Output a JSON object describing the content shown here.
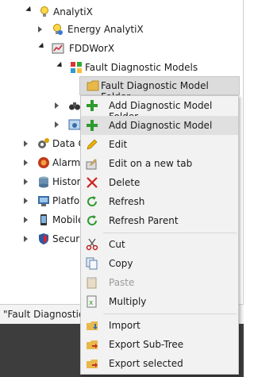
{
  "tree": {
    "analytix": "AnalytiX",
    "energy": "Energy AnalytiX",
    "fddworx": "FDDWorX",
    "fault_models": "Fault Diagnostic Models",
    "selected": "Fault Diagnostic Model Folder",
    "data": "Data C",
    "alarms": "Alarms",
    "historian": "Histori",
    "platform": "Platfor",
    "mobile": "Mobile",
    "security": "Securi"
  },
  "context_menu": {
    "add_folder": "Add Diagnostic Model Folder",
    "add_model": "Add Diagnostic Model",
    "edit": "Edit",
    "edit_new_tab": "Edit on a new tab",
    "delete": "Delete",
    "refresh": "Refresh",
    "refresh_parent": "Refresh Parent",
    "cut": "Cut",
    "copy": "Copy",
    "paste": "Paste",
    "multiply": "Multiply",
    "import": "Import",
    "export_subtree": "Export Sub-Tree",
    "export_selected": "Export selected"
  },
  "status": {
    "text": "\"Fault Diagnostic I"
  },
  "colors": {
    "green_plus": "#2e9a2e",
    "red_x": "#d02020",
    "folder": "#e8b84a"
  }
}
